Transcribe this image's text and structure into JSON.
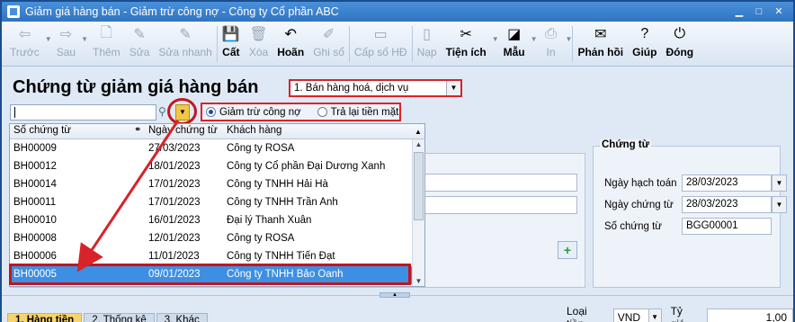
{
  "window": {
    "title": "Giảm giá hàng bán - Giảm trừ công nợ - Công ty Cổ phần ABC"
  },
  "toolbar": {
    "items": [
      {
        "label": "Trước",
        "icon": "arrow-left-icon",
        "glyph": "⇦",
        "enabled": false,
        "caret": true
      },
      {
        "label": "Sau",
        "icon": "arrow-right-icon",
        "glyph": "⇨",
        "enabled": false,
        "caret": true
      },
      {
        "label": "Thêm",
        "icon": "add-doc-icon",
        "glyph": "🗋",
        "enabled": false
      },
      {
        "label": "Sửa",
        "icon": "edit-icon",
        "glyph": "✎",
        "enabled": false
      },
      {
        "label": "Sửa nhanh",
        "icon": "quick-edit-icon",
        "glyph": "✎",
        "enabled": false
      },
      {
        "label": "Cất",
        "icon": "save-icon",
        "glyph": "💾",
        "enabled": true
      },
      {
        "label": "Xóa",
        "icon": "delete-icon",
        "glyph": "🗑",
        "enabled": false
      },
      {
        "label": "Hoãn",
        "icon": "undo-icon",
        "glyph": "↶",
        "enabled": true
      },
      {
        "label": "Ghi sổ",
        "icon": "post-icon",
        "glyph": "✐",
        "enabled": false
      },
      {
        "label": "Cấp số HĐ",
        "icon": "invoice-number-icon",
        "glyph": "▭",
        "enabled": false
      },
      {
        "label": "Nạp",
        "icon": "reload-icon",
        "glyph": "▯",
        "enabled": false
      },
      {
        "label": "Tiện ích",
        "icon": "tools-icon",
        "glyph": "✂",
        "enabled": true,
        "caret": true
      },
      {
        "label": "Mẫu",
        "icon": "template-icon",
        "glyph": "◪",
        "enabled": true,
        "caret": true
      },
      {
        "label": "In",
        "icon": "print-icon",
        "glyph": "⎙",
        "enabled": false,
        "caret": true
      },
      {
        "label": "Phản hồi",
        "icon": "feedback-mail-icon",
        "glyph": "✉",
        "enabled": true
      },
      {
        "label": "Giúp",
        "icon": "help-icon",
        "glyph": "?",
        "enabled": true
      },
      {
        "label": "Đóng",
        "icon": "close-power-icon",
        "glyph": "⏻",
        "enabled": true
      }
    ]
  },
  "page": {
    "title": "Chứng từ giảm giá hàng bán"
  },
  "type_select": {
    "value": "1. Bán hàng hoá, dịch vụ"
  },
  "options": {
    "deduct_debt": "Giảm trừ công nợ",
    "refund_cash": "Trả lại tiền mặt",
    "selected": "deduct_debt"
  },
  "lookup": {
    "headers": {
      "doc_no": "Số chứng từ",
      "doc_date": "Ngày chứng từ",
      "customer": "Khách hàng"
    },
    "rows": [
      {
        "doc_no": "BH00009",
        "doc_date": "27/03/2023",
        "customer": "Công ty ROSA"
      },
      {
        "doc_no": "BH00012",
        "doc_date": "18/01/2023",
        "customer": "Công ty Cổ phần Đại Dương Xanh"
      },
      {
        "doc_no": "BH00014",
        "doc_date": "17/01/2023",
        "customer": "Công ty TNHH Hải Hà"
      },
      {
        "doc_no": "BH00011",
        "doc_date": "17/01/2023",
        "customer": "Công ty TNHH Trần Anh"
      },
      {
        "doc_no": "BH00010",
        "doc_date": "16/01/2023",
        "customer": "Đại lý Thanh Xuân"
      },
      {
        "doc_no": "BH00008",
        "doc_date": "12/01/2023",
        "customer": "Công ty ROSA"
      },
      {
        "doc_no": "BH00006",
        "doc_date": "11/01/2023",
        "customer": "Công ty TNHH Tiến Đạt"
      },
      {
        "doc_no": "BH00005",
        "doc_date": "09/01/2023",
        "customer": "Công ty TNHH Bảo Oanh"
      }
    ],
    "selected_index": 7
  },
  "voucher": {
    "legend": "Chứng từ",
    "posting_date_label": "Ngày hạch toán",
    "posting_date": "28/03/2023",
    "voucher_date_label": "Ngày chứng từ",
    "voucher_date": "28/03/2023",
    "voucher_no_label": "Số chứng từ",
    "voucher_no": "BGG00001"
  },
  "bottom": {
    "tabs": [
      "1. Hàng tiền",
      "2. Thống kê",
      "3. Khác"
    ],
    "currency_label": "Loại tiền",
    "currency": "VND",
    "rate_label": "Tỷ giá",
    "rate": "1,00"
  },
  "colors": {
    "highlight": "#d8232a",
    "selection": "#3d8fe3",
    "title_bar": "#2f74c2"
  }
}
